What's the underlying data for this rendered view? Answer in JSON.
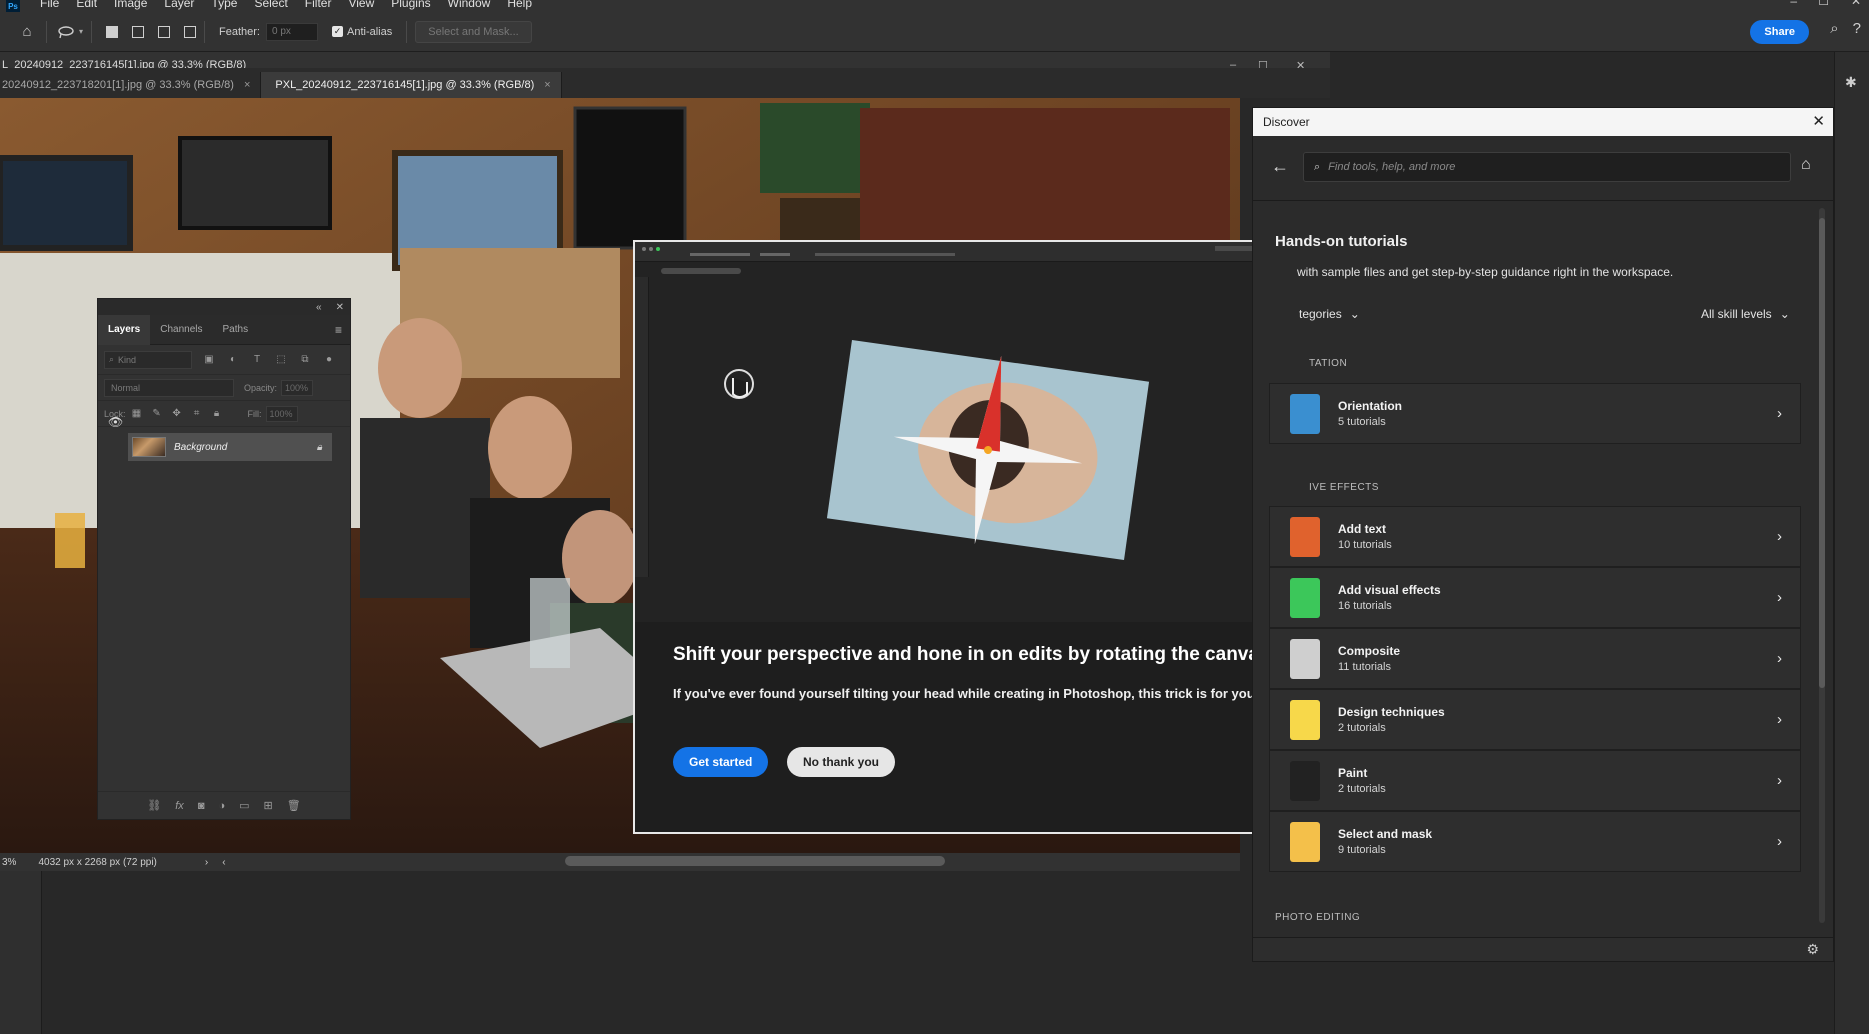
{
  "menubar": {
    "items": [
      "File",
      "Edit",
      "Image",
      "Layer",
      "Type",
      "Select",
      "Filter",
      "View",
      "Plugins",
      "Window",
      "Help"
    ]
  },
  "options_bar": {
    "feather_label": "Feather:",
    "feather_value": "0 px",
    "anti_alias_label": "Anti-alias",
    "select_mask_label": "Select and Mask...",
    "share_label": "Share"
  },
  "document": {
    "title": "L_20240912_223716145[1].jpg @ 33.3% (RGB/8)",
    "tabs": [
      {
        "label": "20240912_223718201[1].jpg @ 33.3% (RGB/8)",
        "active": false
      },
      {
        "label": "PXL_20240912_223716145[1].jpg @ 33.3% (RGB/8)",
        "active": true
      }
    ],
    "close_glyph": "×"
  },
  "status": {
    "zoom": "3%",
    "dimensions": "4032 px x 2268 px (72 ppi)"
  },
  "layers_panel": {
    "tabs": [
      "Layers",
      "Channels",
      "Paths"
    ],
    "kind_placeholder": "Kind",
    "blend_mode": "Normal",
    "opacity_label": "Opacity:",
    "opacity_value": "100%",
    "lock_label": "Lock:",
    "fill_label": "Fill:",
    "fill_value": "100%",
    "layer_name": "Background"
  },
  "tutorial": {
    "heading": "Shift your perspective and hone in on edits by rotating the canvas",
    "body": "If you've ever found yourself tilting your head while creating in Photoshop, this trick is for you.",
    "primary_button": "Get started",
    "secondary_button": "No thank you"
  },
  "discover": {
    "title": "Discover",
    "search_placeholder": "Find tools, help, and more",
    "heading": "Hands-on tutorials",
    "subheading": "with sample files and get step-by-step guidance right in the workspace.",
    "categories_label": "tegories",
    "skill_levels_label": "All skill levels",
    "sections": [
      {
        "label": "TATION",
        "cards": [
          {
            "name": "Orientation",
            "count": "5 tutorials",
            "color": "#3a8fd0"
          }
        ]
      },
      {
        "label": "IVE EFFECTS",
        "cards": [
          {
            "name": "Add text",
            "count": "10 tutorials",
            "color": "#e0622d"
          },
          {
            "name": "Add visual effects",
            "count": "16 tutorials",
            "color": "#3cc75a"
          },
          {
            "name": "Composite",
            "count": "11 tutorials",
            "color": "#cfcfcf"
          },
          {
            "name": "Design techniques",
            "count": "2 tutorials",
            "color": "#f7d84a"
          },
          {
            "name": "Paint",
            "count": "2 tutorials",
            "color": "#222222"
          },
          {
            "name": "Select and mask",
            "count": "9 tutorials",
            "color": "#f4c04a"
          }
        ]
      },
      {
        "label": "PHOTO EDITING",
        "cards": []
      }
    ]
  },
  "colors": {
    "accent": "#1473e6",
    "panel_bg": "#323232",
    "app_bg": "#282828"
  }
}
